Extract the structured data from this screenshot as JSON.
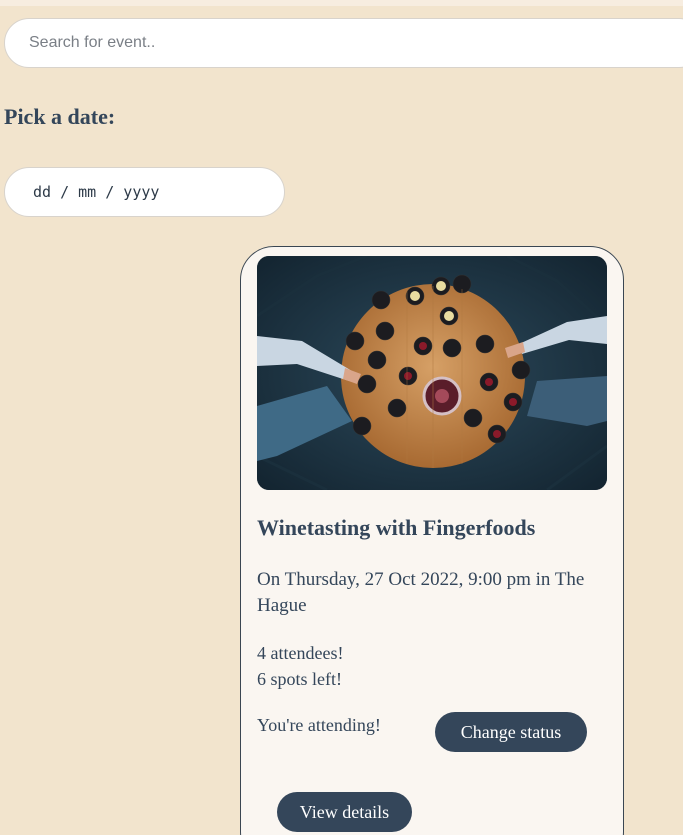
{
  "search": {
    "placeholder": "Search for event.."
  },
  "date_picker": {
    "heading": "Pick a date:",
    "placeholder": "dd / mm / yyyy"
  },
  "event": {
    "title": "Winetasting with Fingerfoods",
    "when": "On Thursday, 27 Oct 2022, 9:00 pm in The Hague",
    "attendees": "4 attendees!",
    "spots_left": "6 spots left!",
    "status": "You're attending!",
    "change_status_label": "Change status",
    "view_details_label": "View details",
    "image_description_icon": "wine-tasting-photo"
  },
  "colors": {
    "background": "#f2e4cd",
    "card": "#faf6f1",
    "accent": "#34465a"
  }
}
